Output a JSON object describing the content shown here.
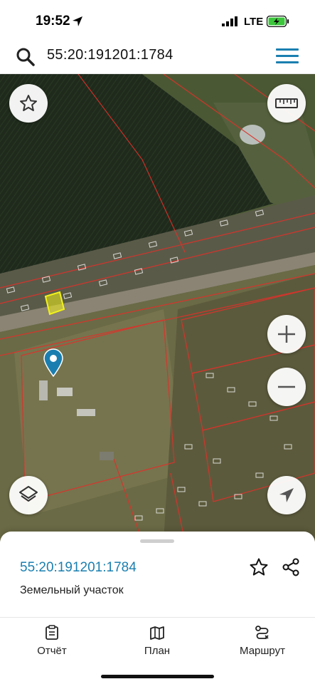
{
  "status_bar": {
    "time": "19:52",
    "network": "LTE"
  },
  "search": {
    "query": "55:20:191201:1784"
  },
  "map": {
    "controls": [
      "favorite",
      "ruler",
      "zoom-in",
      "zoom-out",
      "layers",
      "locate"
    ]
  },
  "sheet": {
    "cadastral_number": "55:20:191201:1784",
    "object_type": "Земельный участок"
  },
  "tabs": [
    {
      "label": "Отчёт",
      "icon": "report-icon"
    },
    {
      "label": "План",
      "icon": "map-plan-icon"
    },
    {
      "label": "Маршрут",
      "icon": "route-icon"
    }
  ],
  "colors": {
    "accent": "#1a7fb0",
    "parcel_highlight": "#f2f21a",
    "parcel_border": "#e0302a"
  }
}
